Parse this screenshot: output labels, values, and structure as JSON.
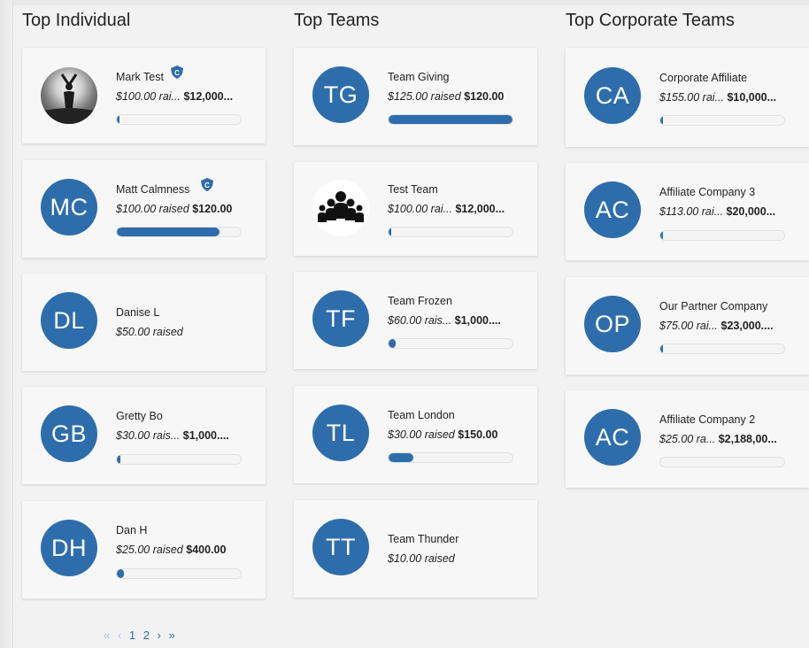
{
  "columns": [
    {
      "title": "Top Individual",
      "items": [
        {
          "initials": "",
          "avatar": "photo",
          "name": "Mark Test",
          "badge": true,
          "raised": "$100.00 rai...",
          "goal": "$12,000...",
          "progress": 0.01
        },
        {
          "initials": "MC",
          "avatar": "initials",
          "name": "Matt Calmness",
          "badge": true,
          "raised": "$100.00 raised",
          "goal": "$120.00",
          "progress": 0.83
        },
        {
          "initials": "DL",
          "avatar": "initials",
          "name": "Danise L",
          "badge": false,
          "raised": "$50.00 raised",
          "goal": "",
          "progress": null
        },
        {
          "initials": "GB",
          "avatar": "initials",
          "name": "Gretty Bo",
          "badge": false,
          "raised": "$30.00 rais...",
          "goal": "$1,000....",
          "progress": 0.03
        },
        {
          "initials": "DH",
          "avatar": "initials",
          "name": "Dan H",
          "badge": false,
          "raised": "$25.00 raised",
          "goal": "$400.00",
          "progress": 0.06
        }
      ]
    },
    {
      "title": "Top Teams",
      "items": [
        {
          "initials": "TG",
          "avatar": "initials",
          "name": "Team Giving",
          "badge": false,
          "raised": "$125.00 raised",
          "goal": "$120.00",
          "progress": 1.0
        },
        {
          "initials": "",
          "avatar": "group",
          "name": "Test Team",
          "badge": false,
          "raised": "$100.00 rai...",
          "goal": "$12,000...",
          "progress": 0.01
        },
        {
          "initials": "TF",
          "avatar": "initials",
          "name": "Team Frozen",
          "badge": false,
          "raised": "$60.00 rais...",
          "goal": "$1,000....",
          "progress": 0.06
        },
        {
          "initials": "TL",
          "avatar": "initials",
          "name": "Team London",
          "badge": false,
          "raised": "$30.00 raised",
          "goal": "$150.00",
          "progress": 0.2
        },
        {
          "initials": "TT",
          "avatar": "initials",
          "name": "Team Thunder",
          "badge": false,
          "raised": "$10.00 raised",
          "goal": "",
          "progress": null
        }
      ]
    },
    {
      "title": "Top Corporate Teams",
      "items": [
        {
          "initials": "CA",
          "avatar": "initials",
          "name": "Corporate Affiliate",
          "badge": false,
          "raised": "$155.00 rai...",
          "goal": "$10,000...",
          "progress": 0.016
        },
        {
          "initials": "AC",
          "avatar": "initials",
          "name": "Affiliate Company 3",
          "badge": false,
          "raised": "$113.00 rai...",
          "goal": "$20,000...",
          "progress": 0.006
        },
        {
          "initials": "OP",
          "avatar": "initials",
          "name": "Our Partner Company",
          "badge": false,
          "raised": "$75.00 rai...",
          "goal": "$23,000....",
          "progress": 0.003
        },
        {
          "initials": "AC",
          "avatar": "initials",
          "name": "Affiliate Company 2",
          "badge": false,
          "raised": "$25.00 ra...",
          "goal": "$2,188,00...",
          "progress": 0.0
        }
      ]
    }
  ],
  "pagination": {
    "first": "«",
    "prev": "‹",
    "pages": [
      "1",
      "2"
    ],
    "next": "›",
    "last": "»"
  },
  "colors": {
    "accent": "#2e6dab",
    "card": "#f7f7f7",
    "background": "#f2f2f2"
  },
  "icons": {
    "badge": "captain-badge-icon",
    "group": "group-people-icon",
    "photo": "user-photo-avatar"
  }
}
